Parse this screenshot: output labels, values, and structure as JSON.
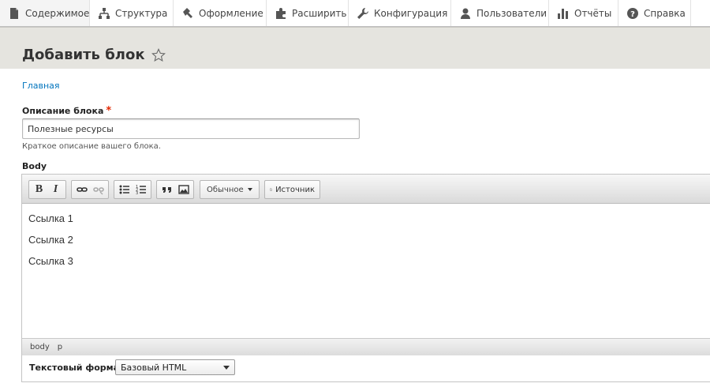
{
  "toolbar": {
    "items": [
      {
        "label": "Содержимое",
        "icon": "content-icon"
      },
      {
        "label": "Структура",
        "icon": "structure-icon"
      },
      {
        "label": "Оформление",
        "icon": "appearance-icon"
      },
      {
        "label": "Расширить",
        "icon": "extend-icon"
      },
      {
        "label": "Конфигурация",
        "icon": "wrench-icon"
      },
      {
        "label": "Пользователи",
        "icon": "people-icon"
      },
      {
        "label": "Отчёты",
        "icon": "reports-icon"
      },
      {
        "label": "Справка",
        "icon": "help-icon"
      }
    ]
  },
  "page": {
    "title": "Добавить блок",
    "breadcrumb": "Главная"
  },
  "form": {
    "description_label": "Описание блока",
    "required_mark": "*",
    "description_value": "Полезные ресурсы",
    "description_help": "Краткое описание вашего блока.",
    "body_label": "Body",
    "editor": {
      "bold": "B",
      "italic": "I",
      "format_dropdown": "Обычное",
      "source_label": "Источник",
      "content": [
        "Ссылка 1",
        "Ссылка 2",
        "Ссылка 3"
      ],
      "path": [
        "body",
        "p"
      ]
    },
    "text_format_label": "Текстовый формат",
    "text_format_value": "Базовый HTML"
  },
  "colors": {
    "link": "#0074bd",
    "required": "#e32700",
    "header_bg": "#e5e4df"
  }
}
